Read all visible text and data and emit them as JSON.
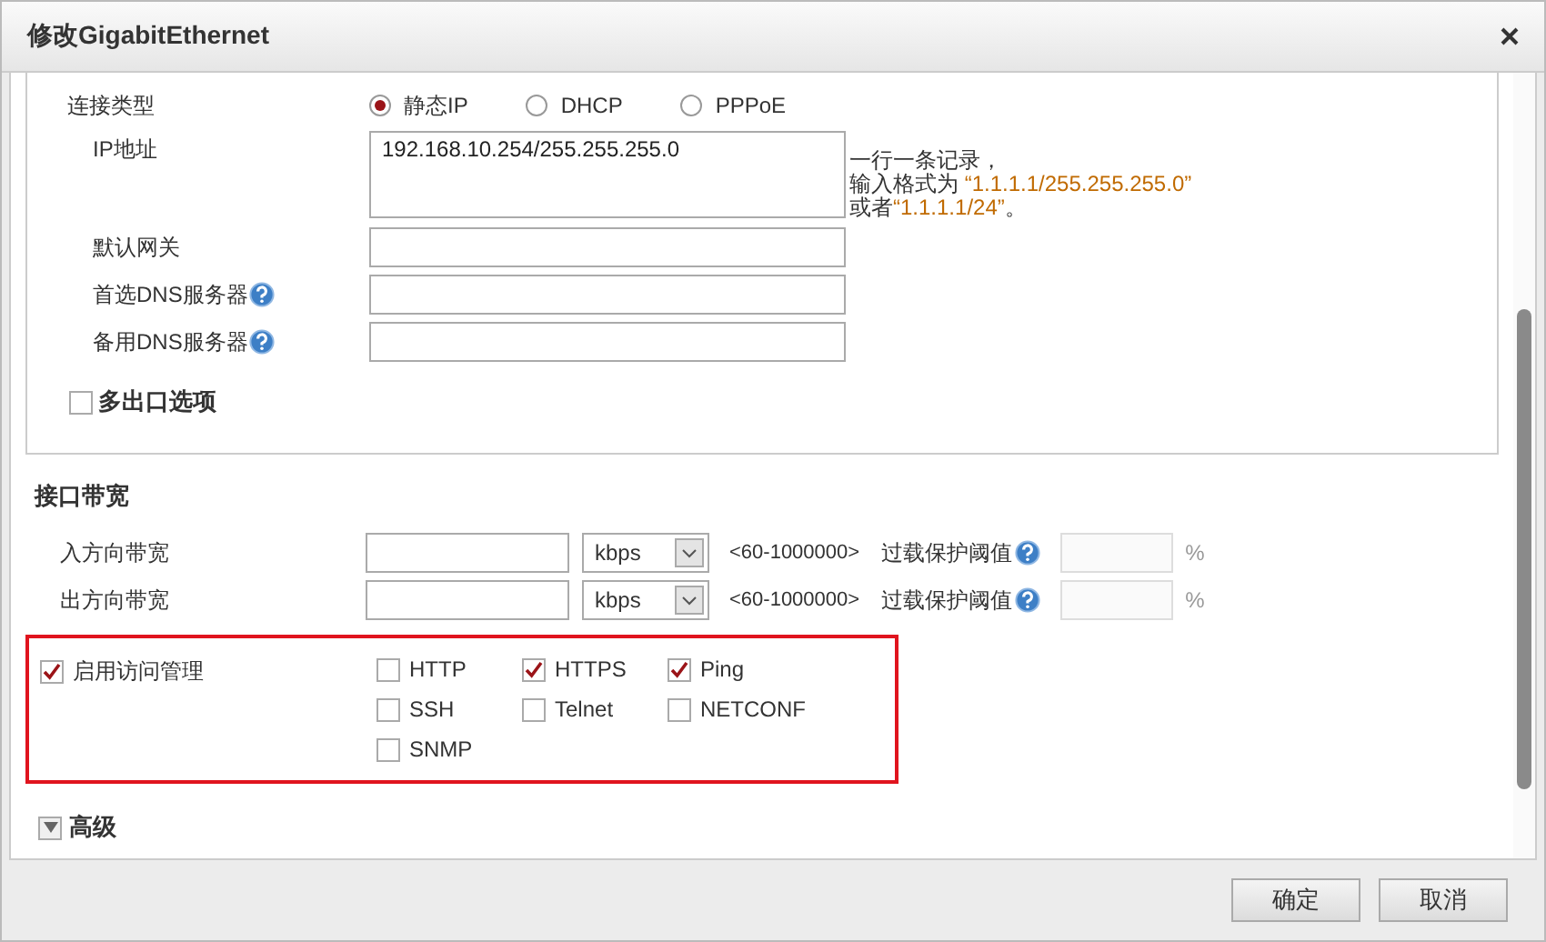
{
  "window": {
    "title": "修改GigabitEthernet"
  },
  "connection": {
    "label": "连接类型",
    "options": [
      {
        "label": "静态IP",
        "selected": true
      },
      {
        "label": "DHCP",
        "selected": false
      },
      {
        "label": "PPPoE",
        "selected": false
      }
    ]
  },
  "ip_address": {
    "label": "IP地址",
    "value": "192.168.10.254/255.255.255.0",
    "hint": [
      [
        {
          "text": "一行一条记录，",
          "kind": "plain"
        }
      ],
      [
        {
          "text": "输入格式为 ",
          "kind": "plain"
        },
        {
          "text": "“1.1.1.1/255.255.255.0”",
          "kind": "example"
        }
      ],
      [
        {
          "text": "或者",
          "kind": "plain"
        },
        {
          "text": "“1.1.1.1/24”",
          "kind": "example"
        },
        {
          "text": "。",
          "kind": "plain"
        }
      ]
    ]
  },
  "fields": [
    {
      "label": "默认网关",
      "help": false
    },
    {
      "label": "首选DNS服务器",
      "help": true
    },
    {
      "label": "备用DNS服务器",
      "help": true
    }
  ],
  "multi_egress": {
    "label": "多出口选项",
    "checked": false
  },
  "bandwidth": {
    "title": "接口带宽",
    "rows": [
      {
        "label": "入方向带宽",
        "unit": "kbps",
        "range": "<60-1000000>",
        "threshold_label": "过载保护阈值",
        "percent": "%"
      },
      {
        "label": "出方向带宽",
        "unit": "kbps",
        "range": "<60-1000000>",
        "threshold_label": "过载保护阈值",
        "percent": "%"
      }
    ]
  },
  "access": {
    "label": "启用访问管理",
    "checked": true,
    "protocols": [
      {
        "label": "HTTP",
        "checked": false
      },
      {
        "label": "HTTPS",
        "checked": true
      },
      {
        "label": "Ping",
        "checked": true
      },
      {
        "label": "SSH",
        "checked": false
      },
      {
        "label": "Telnet",
        "checked": false
      },
      {
        "label": "NETCONF",
        "checked": false
      },
      {
        "label": "SNMP",
        "checked": false
      }
    ]
  },
  "advanced": {
    "label": "高级",
    "expanded": false
  },
  "buttons": [
    {
      "label": "确定"
    },
    {
      "label": "取消"
    }
  ]
}
